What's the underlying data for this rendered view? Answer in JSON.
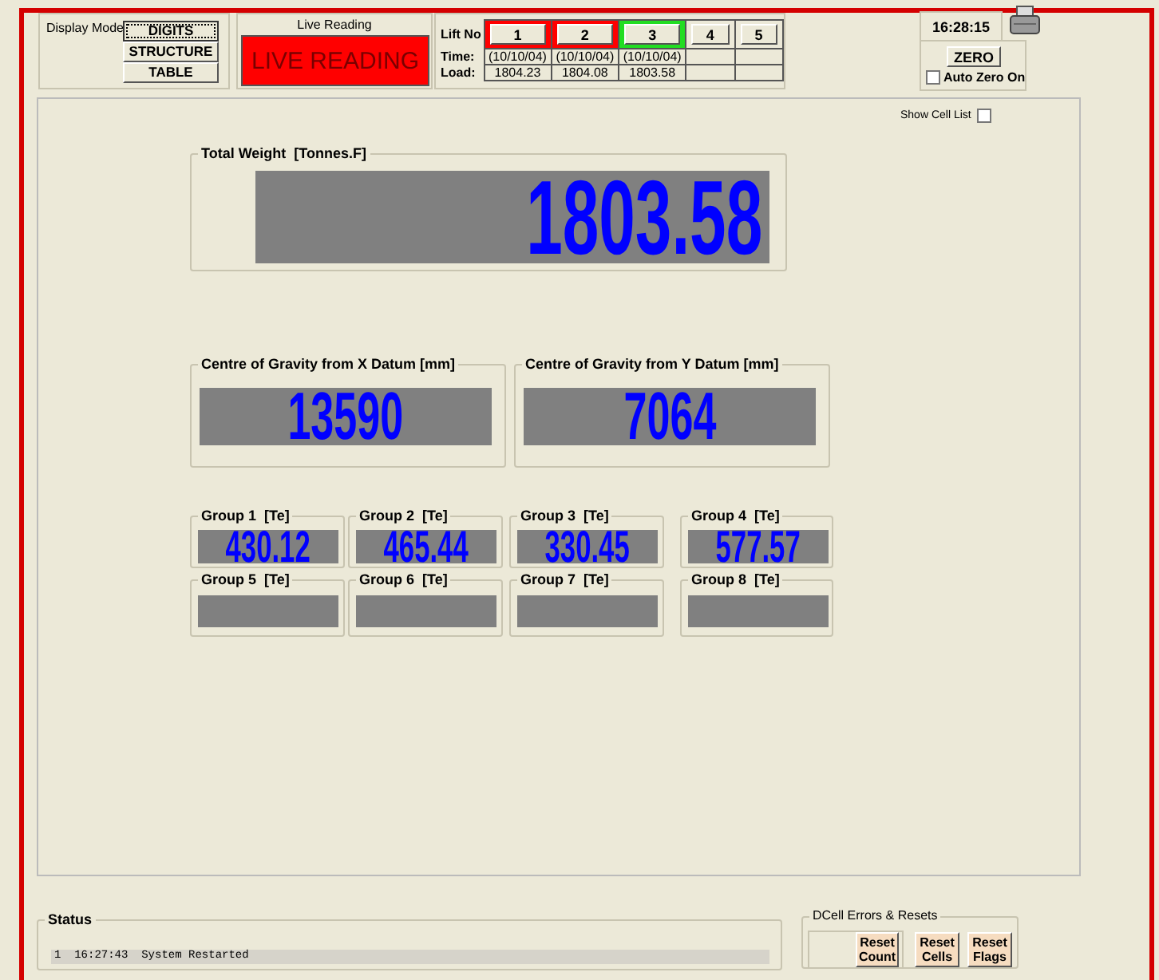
{
  "display_mode": {
    "label": "Display Mode",
    "buttons": [
      {
        "label": "DIGITS",
        "selected": true
      },
      {
        "label": "STRUCTURE",
        "selected": false
      },
      {
        "label": "TABLE",
        "selected": false
      }
    ]
  },
  "live_reading": {
    "title": "Live Reading",
    "indicator": "LIVE READING",
    "color": "#ff0000"
  },
  "lift_table": {
    "row_labels": [
      "Lift No",
      "Time:",
      "Load:"
    ],
    "lifts": [
      {
        "number": "1",
        "color": "#ff0000",
        "time": "(10/10/04)",
        "load": "1804.23"
      },
      {
        "number": "2",
        "color": "#ff0000",
        "time": "(10/10/04)",
        "load": "1804.08"
      },
      {
        "number": "3",
        "color": "#22dd22",
        "time": "(10/10/04)",
        "load": "1803.58"
      },
      {
        "number": "4",
        "color": "#ece9d8"
      },
      {
        "number": "5",
        "color": "#ece9d8"
      }
    ]
  },
  "clock": "16:28:15",
  "zero": {
    "button": "ZERO",
    "auto_zero": {
      "label": "Auto Zero On",
      "checked": false
    }
  },
  "show_cell_list": {
    "label": "Show Cell List",
    "checked": false
  },
  "total_weight": {
    "title": "Total Weight  [Tonnes.F]",
    "value": "1803.58"
  },
  "centre_of_gravity": [
    {
      "title": "Centre of Gravity from X Datum [mm]",
      "value": "13590"
    },
    {
      "title": "Centre of Gravity from Y Datum [mm]",
      "value": "7064"
    }
  ],
  "groups": [
    {
      "title": "Group 1  [Te]",
      "value": "430.12"
    },
    {
      "title": "Group 2  [Te]",
      "value": "465.44"
    },
    {
      "title": "Group 3  [Te]",
      "value": "330.45"
    },
    {
      "title": "Group 4  [Te]",
      "value": "577.57"
    },
    {
      "title": "Group 5  [Te]"
    },
    {
      "title": "Group 6  [Te]"
    },
    {
      "title": "Group 7  [Te]"
    },
    {
      "title": "Group 8  [Te]"
    }
  ],
  "status": {
    "title": "Status",
    "lines": [
      {
        "index": "1",
        "time": "16:27:43",
        "message": "System Restarted"
      }
    ]
  },
  "resets": {
    "title": "DCell Errors & Resets",
    "buttons": [
      "Reset Count",
      "Reset Cells",
      "Reset Flags"
    ]
  }
}
